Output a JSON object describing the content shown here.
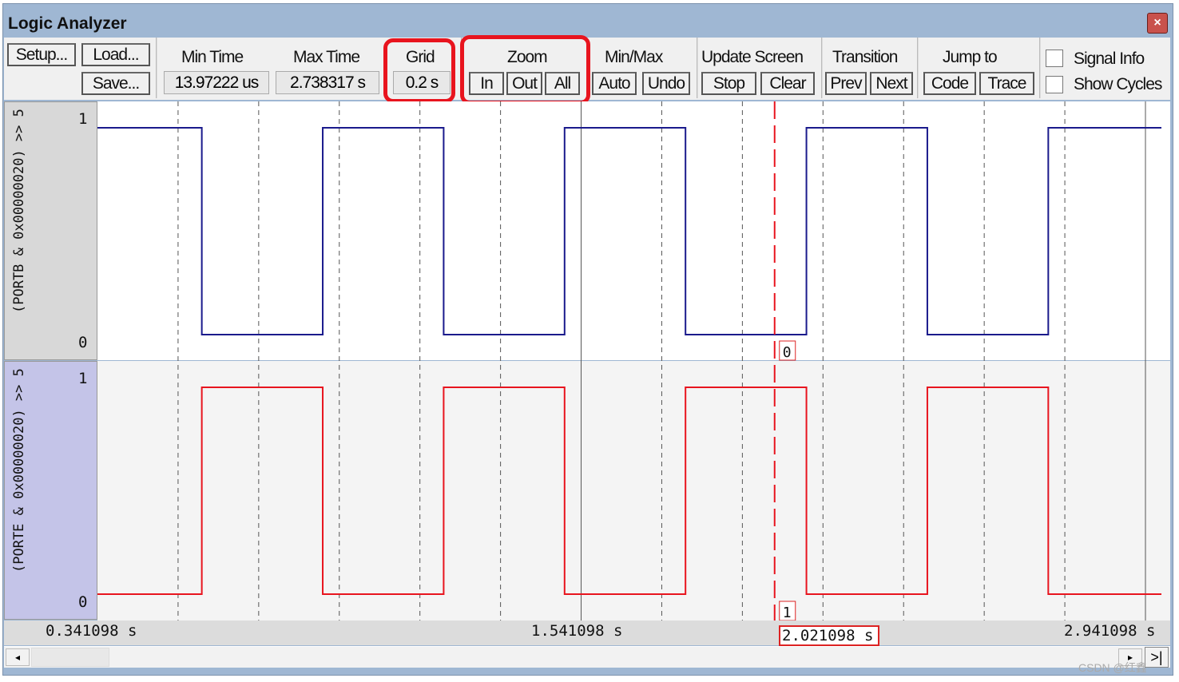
{
  "window": {
    "title": "Logic Analyzer",
    "close_icon": "close-icon"
  },
  "toolbar": {
    "setup": "Setup...",
    "load": "Load...",
    "save": "Save...",
    "min_time_label": "Min Time",
    "min_time": "13.97222 us",
    "max_time_label": "Max Time",
    "max_time": "2.738317 s",
    "grid_label": "Grid",
    "grid": "0.2 s",
    "zoom_label": "Zoom",
    "zoom_in": "In",
    "zoom_out": "Out",
    "zoom_all": "All",
    "minmax_label": "Min/Max",
    "auto": "Auto",
    "undo": "Undo",
    "update_label": "Update Screen",
    "stop": "Stop",
    "clear": "Clear",
    "transition_label": "Transition",
    "prev": "Prev",
    "next": "Next",
    "jump_label": "Jump to",
    "code": "Code",
    "trace": "Trace",
    "signal_info": "Signal Info",
    "signal_info_checked": false,
    "show_cycles": "Show Cycles",
    "show_cycles_checked": false
  },
  "signals": [
    {
      "name": "(PORTB & 0x00000020) >> 5",
      "high_label": "1",
      "low_label": "0",
      "color": "#1a1a8c",
      "label_bg": "#d8d8d8",
      "initial": 1,
      "transitions": [
        0.6,
        0.9,
        1.2,
        1.5,
        1.8,
        2.1,
        2.4,
        2.7
      ],
      "cursor_value": "0"
    },
    {
      "name": "(PORTE & 0x00000020) >> 5",
      "high_label": "1",
      "low_label": "0",
      "color": "#e8141e",
      "label_bg": "#c4c4e8",
      "initial": 0,
      "transitions": [
        0.6,
        0.9,
        1.2,
        1.5,
        1.8,
        2.1,
        2.4,
        2.7
      ],
      "cursor_value": "1"
    }
  ],
  "time_axis": {
    "start": "0.341098 s",
    "mid": "1.541098 s",
    "end": "2.941098 s",
    "cursor": "2.021098 s",
    "start_value": 0.341098,
    "end_value": 2.941098,
    "cursor_value": 2.021098,
    "grid_step": 0.2
  },
  "scrollbar": {
    "end_button": ">|"
  },
  "watermark": "CSDN @红鑫"
}
